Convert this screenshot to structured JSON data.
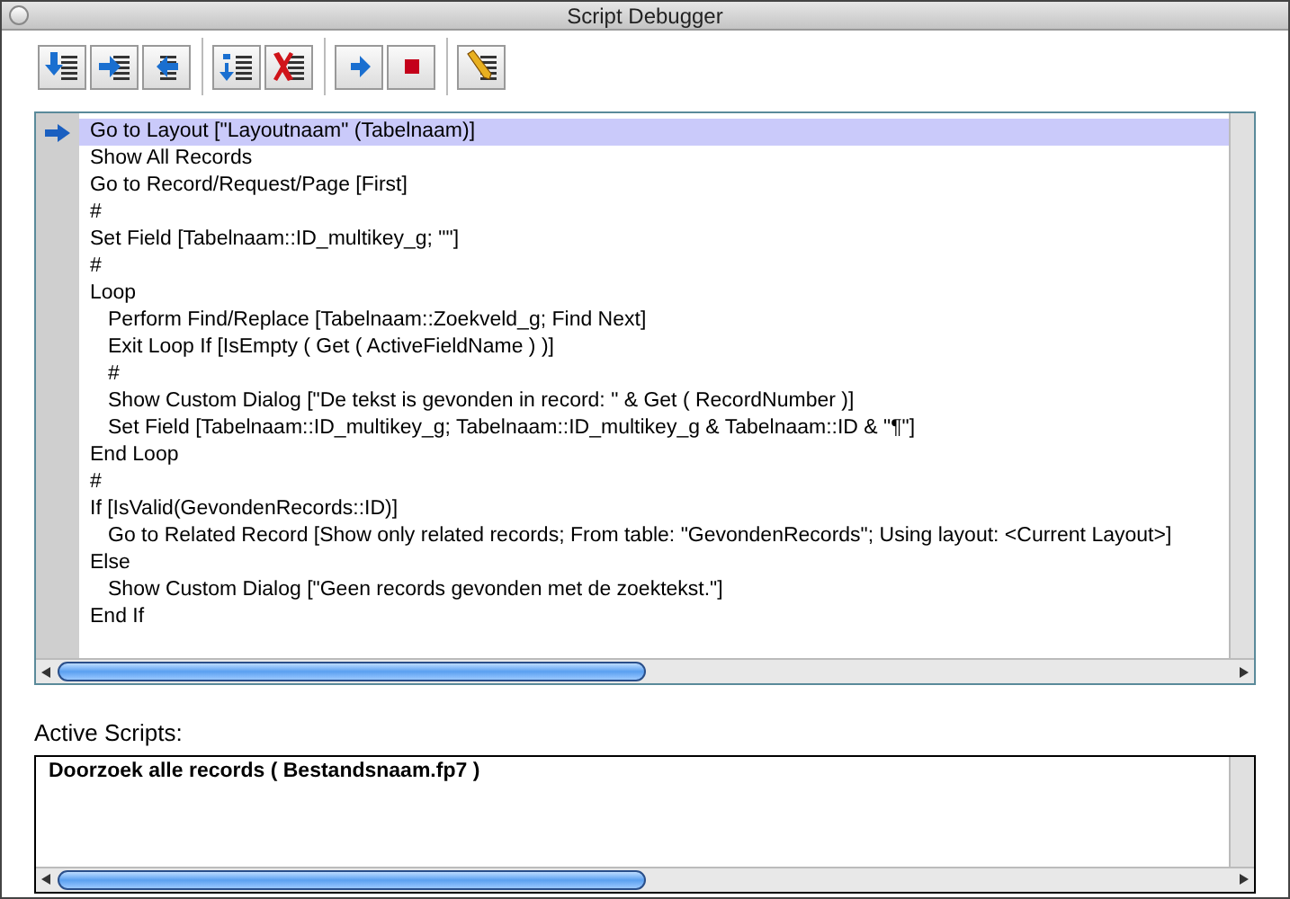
{
  "window": {
    "title": "Script Debugger"
  },
  "toolbar": [
    [
      {
        "kind": "step-into"
      },
      {
        "kind": "step-over"
      },
      {
        "kind": "step-out"
      }
    ],
    [
      {
        "kind": "set-next"
      },
      {
        "kind": "clear-breakpoints"
      }
    ],
    [
      {
        "kind": "run"
      },
      {
        "kind": "halt"
      }
    ],
    [
      {
        "kind": "edit-script"
      }
    ]
  ],
  "script": {
    "lines": [
      {
        "text": "Go to Layout [\"Layoutnaam\" (Tabelnaam)]",
        "selected": true
      },
      {
        "text": "Show All Records",
        "selected": false
      },
      {
        "text": "Go to Record/Request/Page [First]",
        "selected": false
      },
      {
        "text": "#",
        "selected": false
      },
      {
        "text": "Set Field [Tabelnaam::ID_multikey_g; \"\"]",
        "selected": false
      },
      {
        "text": "#",
        "selected": false
      },
      {
        "text": "Loop",
        "selected": false,
        "children": [
          {
            "text": "Perform Find/Replace [Tabelnaam::Zoekveld_g; Find Next]",
            "selected": false
          },
          {
            "text": "Exit Loop If [IsEmpty ( Get ( ActiveFieldName ) )]",
            "selected": false
          },
          {
            "text": "#",
            "selected": false
          },
          {
            "text": "Show Custom Dialog [\"De tekst is gevonden in record: \" & Get ( RecordNumber )]",
            "selected": false
          },
          {
            "text": "Set Field [Tabelnaam::ID_multikey_g; Tabelnaam::ID_multikey_g &  Tabelnaam::ID & \"¶\"]",
            "selected": false
          }
        ]
      },
      {
        "text": "End Loop",
        "selected": false
      },
      {
        "text": "#",
        "selected": false
      },
      {
        "text": "If [IsValid(GevondenRecords::ID)]",
        "selected": false,
        "children": [
          {
            "text": "Go to Related Record [Show only related records; From table: \"GevondenRecords\"; Using layout: <Current Layout>]",
            "selected": false
          }
        ]
      },
      {
        "text": "Else",
        "selected": false,
        "children": [
          {
            "text": "Show Custom Dialog [\"Geen records gevonden met de zoektekst.\"]",
            "selected": false
          }
        ]
      },
      {
        "text": "End If",
        "selected": false
      }
    ]
  },
  "active_scripts": {
    "label": "Active Scripts:",
    "items": [
      {
        "text": "Doorzoek alle records ( Bestandsnaam.fp7 )"
      }
    ]
  }
}
